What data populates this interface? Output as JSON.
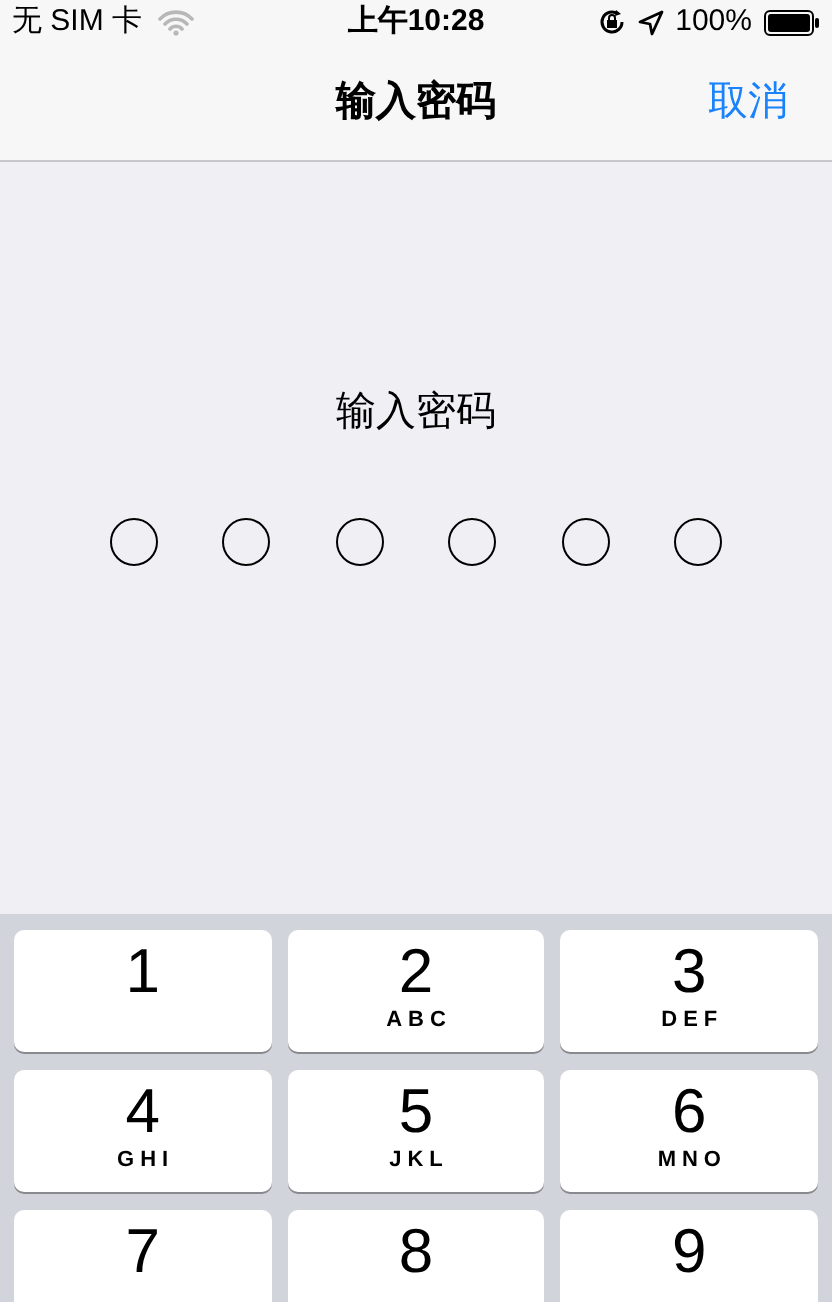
{
  "status_bar": {
    "carrier": "无 SIM 卡",
    "time": "上午10:28",
    "battery": "100%"
  },
  "nav_bar": {
    "title": "输入密码",
    "cancel": "取消"
  },
  "prompt": "输入密码",
  "passcode_dots": [
    {
      "filled": false
    },
    {
      "filled": false
    },
    {
      "filled": false
    },
    {
      "filled": false
    },
    {
      "filled": false
    },
    {
      "filled": false
    }
  ],
  "keypad": [
    {
      "digit": "1"
    },
    {
      "digit": "2",
      "letters": "ABC"
    },
    {
      "digit": "3",
      "letters": "DEF"
    },
    {
      "digit": "4",
      "letters": "GHI"
    },
    {
      "digit": "5",
      "letters": "JKL"
    },
    {
      "digit": "6",
      "letters": "MNO"
    },
    {
      "digit": "7"
    },
    {
      "digit": "8"
    },
    {
      "digit": "9"
    }
  ]
}
